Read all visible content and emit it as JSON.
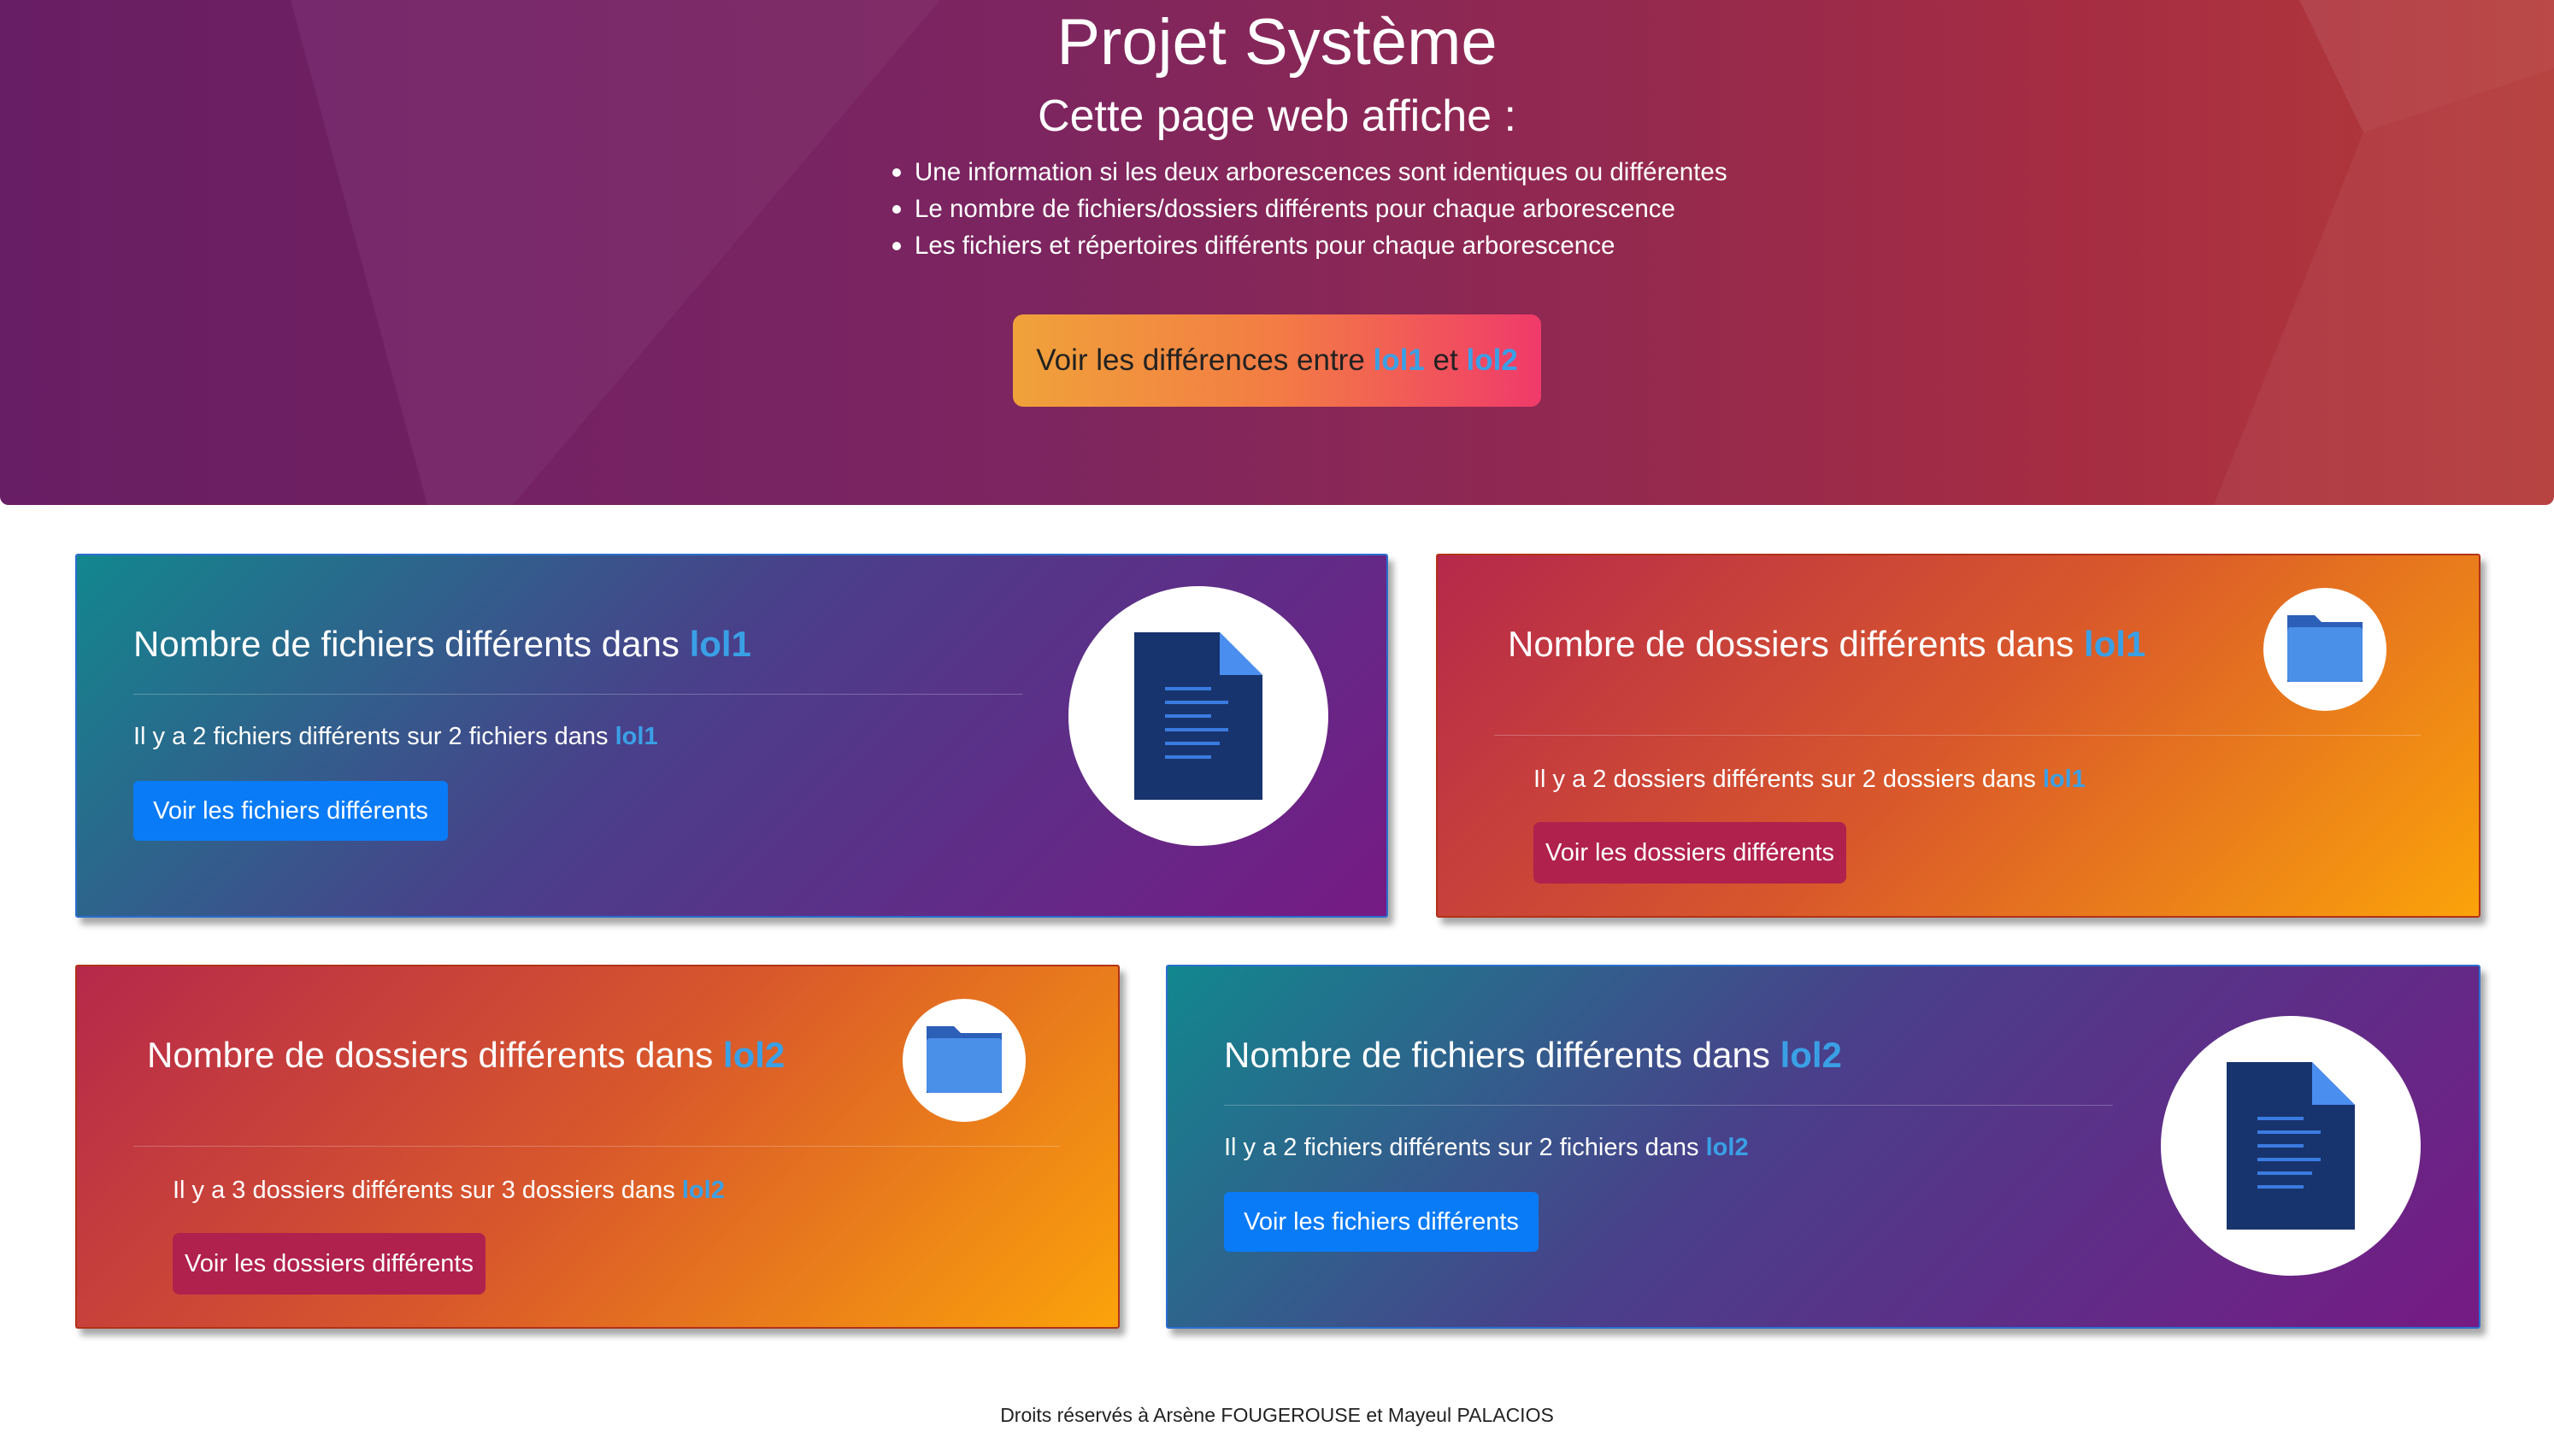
{
  "hero": {
    "title": "Projet Système",
    "subtitle": "Cette page web affiche :",
    "items": [
      "Une information si les deux arborescences sont identiques ou différentes",
      "Le nombre de fichiers/dossiers différents pour chaque arborescence",
      "Les fichiers et répertoires différents pour chaque arborescence"
    ],
    "cta": {
      "prefix": "Voir les différences entre ",
      "tree1": "lol1",
      "middle": " et ",
      "tree2": "lol2"
    }
  },
  "cards": {
    "files_lol1": {
      "title": "Nombre de fichiers différents dans ",
      "tree": "lol1",
      "text": "Il y a 2 fichiers différents sur 2 fichiers dans ",
      "text_tree": "lol1",
      "button": "Voir les fichiers différents",
      "icon": "document-icon"
    },
    "folders_lol1": {
      "title": "Nombre de dossiers différents dans ",
      "tree": "lol1",
      "text": "Il y a 2 dossiers différents sur 2 dossiers dans ",
      "text_tree": "lol1",
      "button": "Voir les dossiers différents",
      "icon": "folder-icon"
    },
    "folders_lol2": {
      "title": "Nombre de dossiers différents dans ",
      "tree": "lol2",
      "text": "Il y a 3 dossiers différents sur 3 dossiers dans ",
      "text_tree": "lol2",
      "button": "Voir les dossiers différents",
      "icon": "folder-icon"
    },
    "files_lol2": {
      "title": "Nombre de fichiers différents dans ",
      "tree": "lol2",
      "text": "Il y a 2 fichiers différents sur 2 fichiers dans ",
      "text_tree": "lol2",
      "button": "Voir les fichiers différents",
      "icon": "document-icon"
    }
  },
  "footer": {
    "text": "Droits réservés à Arsène FOUGEROUSE et Mayeul PALACIOS"
  },
  "colors": {
    "accent": "#3aa0e6",
    "button_blue": "#0a7bf6",
    "button_pink": "#b0214e"
  }
}
